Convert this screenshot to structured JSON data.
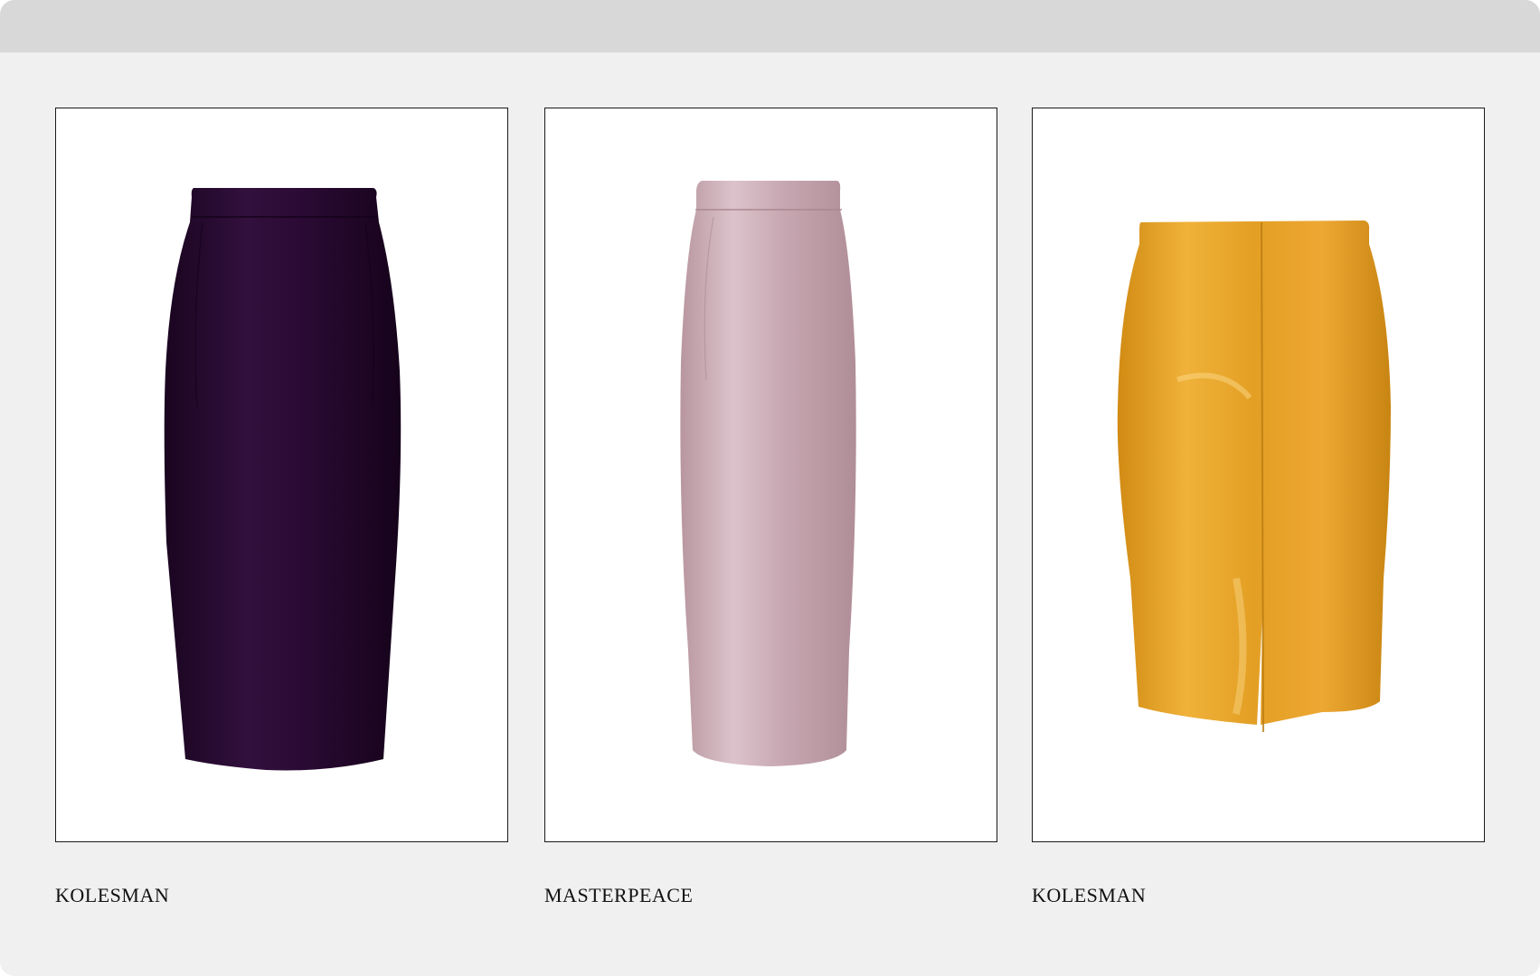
{
  "products": [
    {
      "brand": "KOLESMAN",
      "image": "pencil-skirt-dark-purple",
      "color": "#2b0a33"
    },
    {
      "brand": "MASTERPEACE",
      "image": "pencil-skirt-lilac-satin",
      "color": "#c9aab5"
    },
    {
      "brand": "KOLESMAN",
      "image": "pencil-skirt-mustard-leather",
      "color": "#e6a42a"
    }
  ]
}
